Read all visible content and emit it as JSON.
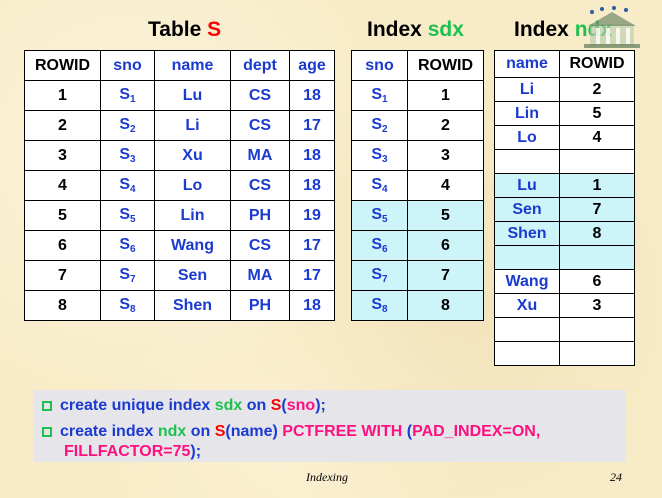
{
  "titles": {
    "table_s": {
      "prefix": "Table ",
      "name": "S"
    },
    "index_sdx": {
      "prefix": "Index ",
      "name": "sdx"
    },
    "index_ndx": {
      "prefix": "Index ",
      "name": "ndx"
    }
  },
  "table_s": {
    "headers": [
      "ROWID",
      "sno",
      "name",
      "dept",
      "age"
    ],
    "rows": [
      {
        "rowid": "1",
        "sno": "S",
        "sub": "1",
        "name": "Lu",
        "dept": "CS",
        "age": "18"
      },
      {
        "rowid": "2",
        "sno": "S",
        "sub": "2",
        "name": "Li",
        "dept": "CS",
        "age": "17"
      },
      {
        "rowid": "3",
        "sno": "S",
        "sub": "3",
        "name": "Xu",
        "dept": "MA",
        "age": "18"
      },
      {
        "rowid": "4",
        "sno": "S",
        "sub": "4",
        "name": "Lo",
        "dept": "CS",
        "age": "18"
      },
      {
        "rowid": "5",
        "sno": "S",
        "sub": "5",
        "name": "Lin",
        "dept": "PH",
        "age": "19"
      },
      {
        "rowid": "6",
        "sno": "S",
        "sub": "6",
        "name": "Wang",
        "dept": "CS",
        "age": "17"
      },
      {
        "rowid": "7",
        "sno": "S",
        "sub": "7",
        "name": "Sen",
        "dept": "MA",
        "age": "17"
      },
      {
        "rowid": "8",
        "sno": "S",
        "sub": "8",
        "name": "Shen",
        "dept": "PH",
        "age": "18"
      }
    ]
  },
  "index_sdx": {
    "headers": [
      "sno",
      "ROWID"
    ],
    "rows": [
      {
        "sno": "S",
        "sub": "1",
        "rowid": "1"
      },
      {
        "sno": "S",
        "sub": "2",
        "rowid": "2"
      },
      {
        "sno": "S",
        "sub": "3",
        "rowid": "3"
      },
      {
        "sno": "S",
        "sub": "4",
        "rowid": "4"
      },
      {
        "sno": "S",
        "sub": "5",
        "rowid": "5"
      },
      {
        "sno": "S",
        "sub": "6",
        "rowid": "6"
      },
      {
        "sno": "S",
        "sub": "7",
        "rowid": "7"
      },
      {
        "sno": "S",
        "sub": "8",
        "rowid": "8"
      }
    ]
  },
  "index_ndx": {
    "headers": [
      "name",
      "ROWID"
    ],
    "rows": [
      {
        "name": "Li",
        "rowid": "2"
      },
      {
        "name": "Lin",
        "rowid": "5"
      },
      {
        "name": "Lo",
        "rowid": "4"
      },
      {
        "name": "",
        "rowid": ""
      },
      {
        "name": "Lu",
        "rowid": "1"
      },
      {
        "name": "Sen",
        "rowid": "7"
      },
      {
        "name": "Shen",
        "rowid": "8"
      },
      {
        "name": "",
        "rowid": ""
      },
      {
        "name": "Wang",
        "rowid": "6"
      },
      {
        "name": "Xu",
        "rowid": "3"
      },
      {
        "name": "",
        "rowid": ""
      },
      {
        "name": "",
        "rowid": ""
      }
    ]
  },
  "code": {
    "line1": {
      "a": "create unique index ",
      "b": "sdx",
      "c": " on ",
      "d": "S",
      "e": "(",
      "f": "sno",
      "g": ");"
    },
    "line2": {
      "a": "create index ",
      "b": "ndx",
      "c": " on ",
      "d": "S",
      "e": "(name) ",
      "f": "PCTFREE WITH",
      "g": " (",
      "h": "PAD_INDEX=ON,"
    },
    "line3": {
      "a": "FILLFACTOR=75",
      "b": ");"
    }
  },
  "footer": {
    "title": "Indexing",
    "page": "24"
  },
  "colors": {
    "header_red": "#ff0000",
    "value_blue": "#1a3ad0",
    "accent_green": "#1fbf50",
    "keyword_pink": "#ff1080",
    "highlight_cyan": "#cdf4f8",
    "code_bg": "#e6e6ea"
  }
}
